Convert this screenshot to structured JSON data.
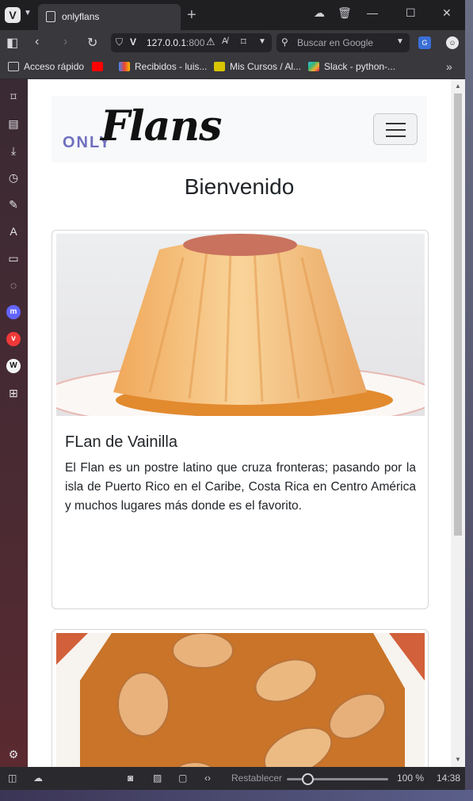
{
  "browser": {
    "tab_title": "onlyflans",
    "url_host": "127.0.0.1",
    "url_port": ":800",
    "search_placeholder": "Buscar en Google",
    "bookmarks": [
      {
        "label": "Acceso rápido",
        "color": "#cfcfd4"
      },
      {
        "label": "",
        "color": "#ff0000"
      },
      {
        "label": "Recibidos - luis...",
        "color": "#ea4335"
      },
      {
        "label": "Mis Cursos / Al...",
        "color": "#d9c400"
      },
      {
        "label": "Slack - python-...",
        "color": "#e01e5a"
      }
    ],
    "sidebar_icons": [
      "bookmark-icon",
      "reading-list-icon",
      "download-icon",
      "history-icon",
      "notes-icon",
      "translate-icon",
      "window-icon",
      "chat-icon",
      "mastodon-icon",
      "vivaldi-icon",
      "wikipedia-icon",
      "add-panel-icon",
      "settings-icon"
    ]
  },
  "status": {
    "reset_label": "Restablecer",
    "zoom": "100 %",
    "zoom_level": 0.15,
    "time": "14:38"
  },
  "page": {
    "brand_only": "ONLY",
    "brand_flans": "Flans",
    "heading": "Bienvenido",
    "cards": [
      {
        "title": "FLan de Vainilla",
        "text": "El Flan es un postre latino que cruza fronteras; pasando por la isla de Puerto Rico en el Caribe, Costa Rica en Centro América y muchos lugares más donde es el favorito."
      },
      {
        "title": "",
        "text": ""
      }
    ]
  }
}
